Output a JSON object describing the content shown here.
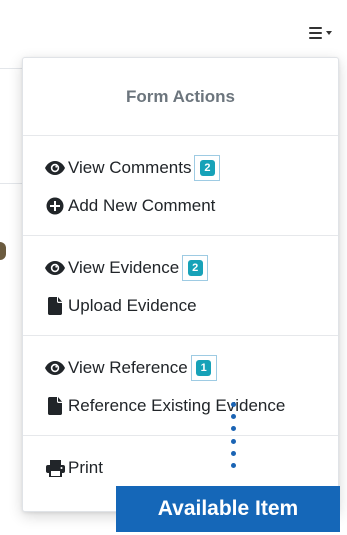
{
  "menu": {
    "toggle_icon": "hamburger-icon"
  },
  "dropdown": {
    "header": "Form Actions",
    "sections": [
      {
        "items": [
          {
            "label": "View Comments",
            "icon": "eye-icon",
            "badge": "2"
          },
          {
            "label": "Add New Comment",
            "icon": "plus-circle-icon"
          }
        ]
      },
      {
        "items": [
          {
            "label": "View Evidence",
            "icon": "eye-icon",
            "badge": "2"
          },
          {
            "label": "Upload Evidence",
            "icon": "file-icon"
          }
        ]
      },
      {
        "items": [
          {
            "label": "View Reference",
            "icon": "eye-icon",
            "badge": "1"
          },
          {
            "label": "Reference Existing Evidence",
            "icon": "file-icon"
          }
        ]
      },
      {
        "items": [
          {
            "label": "Print",
            "icon": "printer-icon"
          }
        ]
      }
    ]
  },
  "callout": {
    "label": "Available Item"
  },
  "colors": {
    "badge": "#17a2b8",
    "callout": "#1567b8",
    "connector": "#1b64b4"
  }
}
